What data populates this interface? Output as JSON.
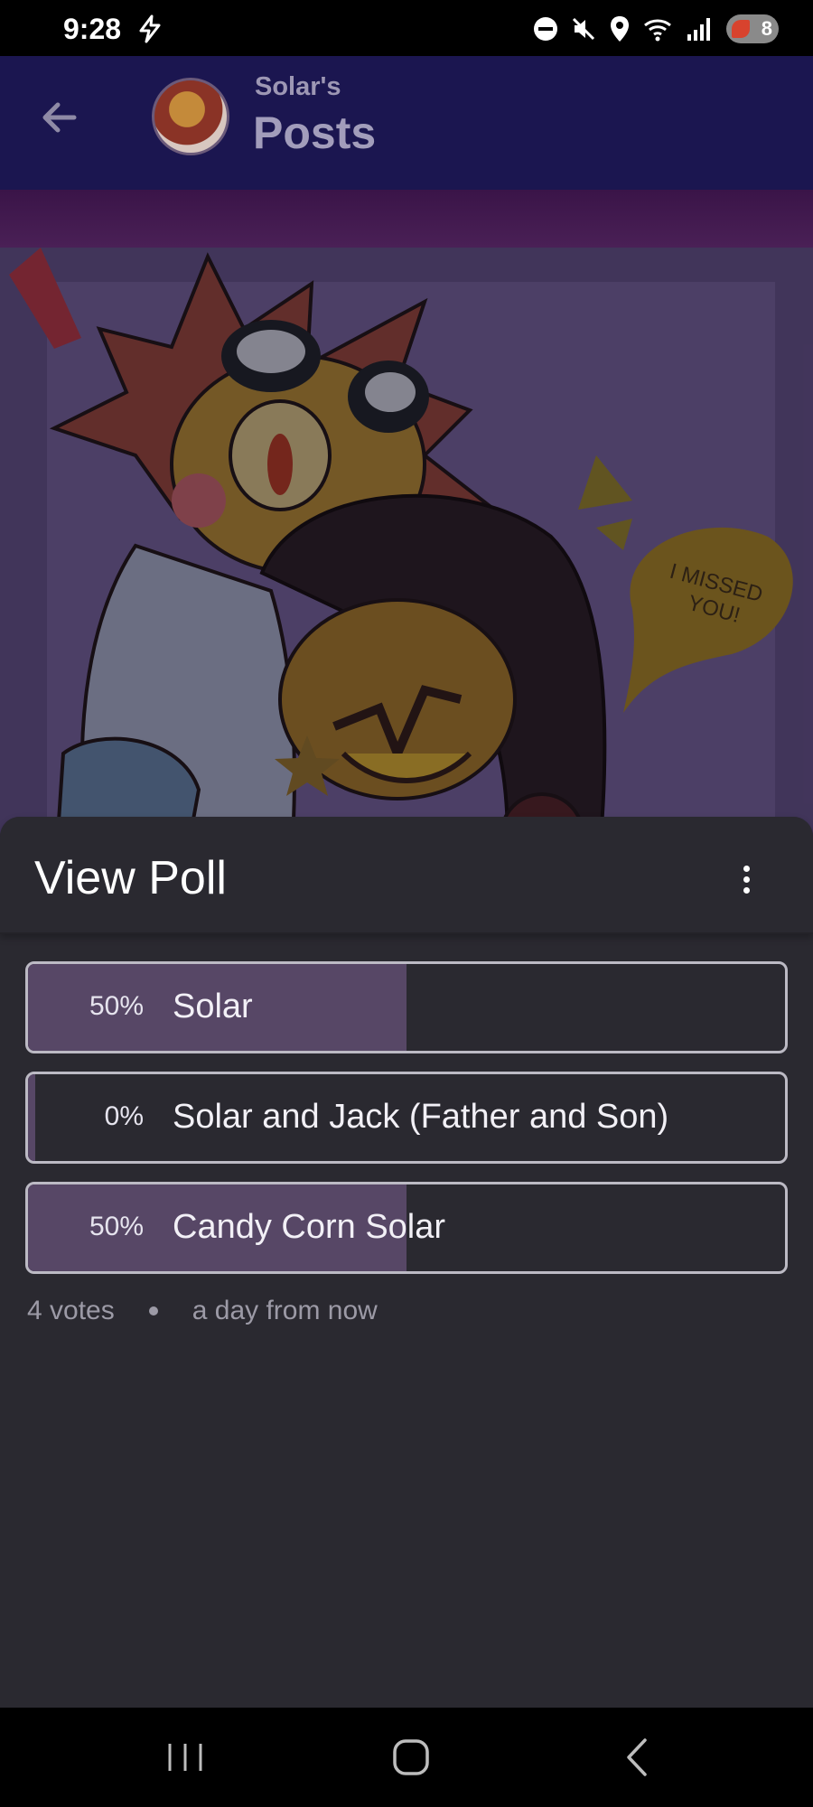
{
  "status_bar": {
    "time": "9:28",
    "battery_level": "8"
  },
  "header": {
    "subtitle": "Solar's",
    "title": "Posts"
  },
  "poll": {
    "title": "View Poll",
    "options": [
      {
        "percent_label": "50%",
        "label": "Solar",
        "fill_fraction": 0.5
      },
      {
        "percent_label": "0%",
        "label": "Solar and Jack (Father and Son)",
        "fill_fraction": 0.0
      },
      {
        "percent_label": "50%",
        "label": "Candy Corn Solar",
        "fill_fraction": 0.5
      }
    ],
    "votes": "4 votes",
    "time_remaining": "a day from now"
  },
  "colors": {
    "header_bg": "#1b1650",
    "sheet_bg": "#2a2930",
    "poll_fill": "#574766",
    "poll_border": "#bcbac4"
  },
  "icons": {
    "back": "arrow-left-icon",
    "menu": "more-vertical-icon",
    "nav_recents": "recents-icon",
    "nav_home": "home-icon",
    "nav_back": "chevron-left-icon"
  }
}
